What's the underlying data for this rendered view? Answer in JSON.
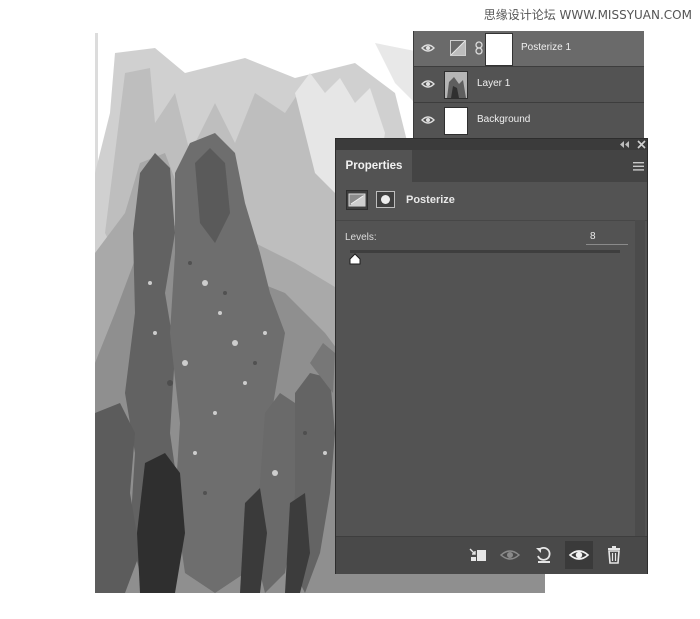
{
  "watermark": "思缘设计论坛 WWW.MISSYUAN.COM",
  "layers": [
    {
      "name": "Posterize 1",
      "type": "adjustment",
      "visible": true,
      "selected": true
    },
    {
      "name": "Layer 1",
      "type": "image",
      "visible": true,
      "selected": false
    },
    {
      "name": "Background",
      "type": "fill",
      "visible": true,
      "selected": false
    }
  ],
  "properties": {
    "tab_label": "Properties",
    "adjustment_title": "Posterize",
    "levels_label": "Levels:",
    "levels_value": "8",
    "levels_slider_fraction": 0.0
  },
  "icons": {
    "eye": "eye-icon",
    "link": "link-icon",
    "collapse": "double-chevron-icon",
    "close": "close-icon",
    "menu": "panel-menu-icon",
    "clip": "clip-to-layer-icon",
    "view_previous": "view-previous-state-icon",
    "reset": "reset-icon",
    "visibility": "toggle-visibility-icon",
    "delete": "trash-icon"
  },
  "colors": {
    "panel_bg": "#535353",
    "selected_row": "#6a6a6a",
    "text": "#f0f0f0"
  }
}
